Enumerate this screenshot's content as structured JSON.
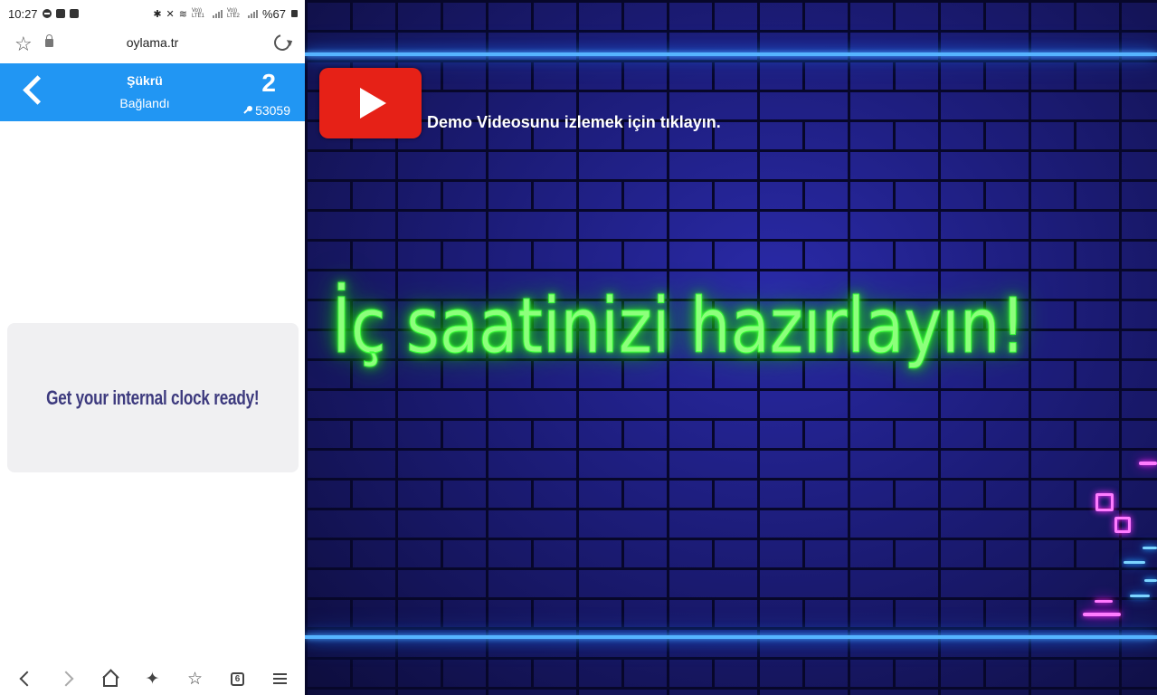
{
  "statusbar": {
    "time": "10:27",
    "battery": "%67",
    "sim1": "Vo)) LTE1",
    "sim2": "Vo)) LTE2"
  },
  "browser": {
    "url": "oylama.tr"
  },
  "app_header": {
    "name": "Şükrü",
    "status": "Bağlandı",
    "count": "2",
    "pin": "53059"
  },
  "card": {
    "message": "Get your internal clock ready!"
  },
  "bottom_nav": {
    "tabs_count": "6"
  },
  "promo": {
    "demo_link": "Demo Videosunu izlemek için tıklayın.",
    "headline": "İç saatinizi hazırlayın!"
  },
  "colors": {
    "header_blue": "#2196f3",
    "neon_green": "#8dff7c",
    "neon_blue": "#56b4ff",
    "youtube_red": "#e62117",
    "card_text": "#3d3a7e"
  }
}
